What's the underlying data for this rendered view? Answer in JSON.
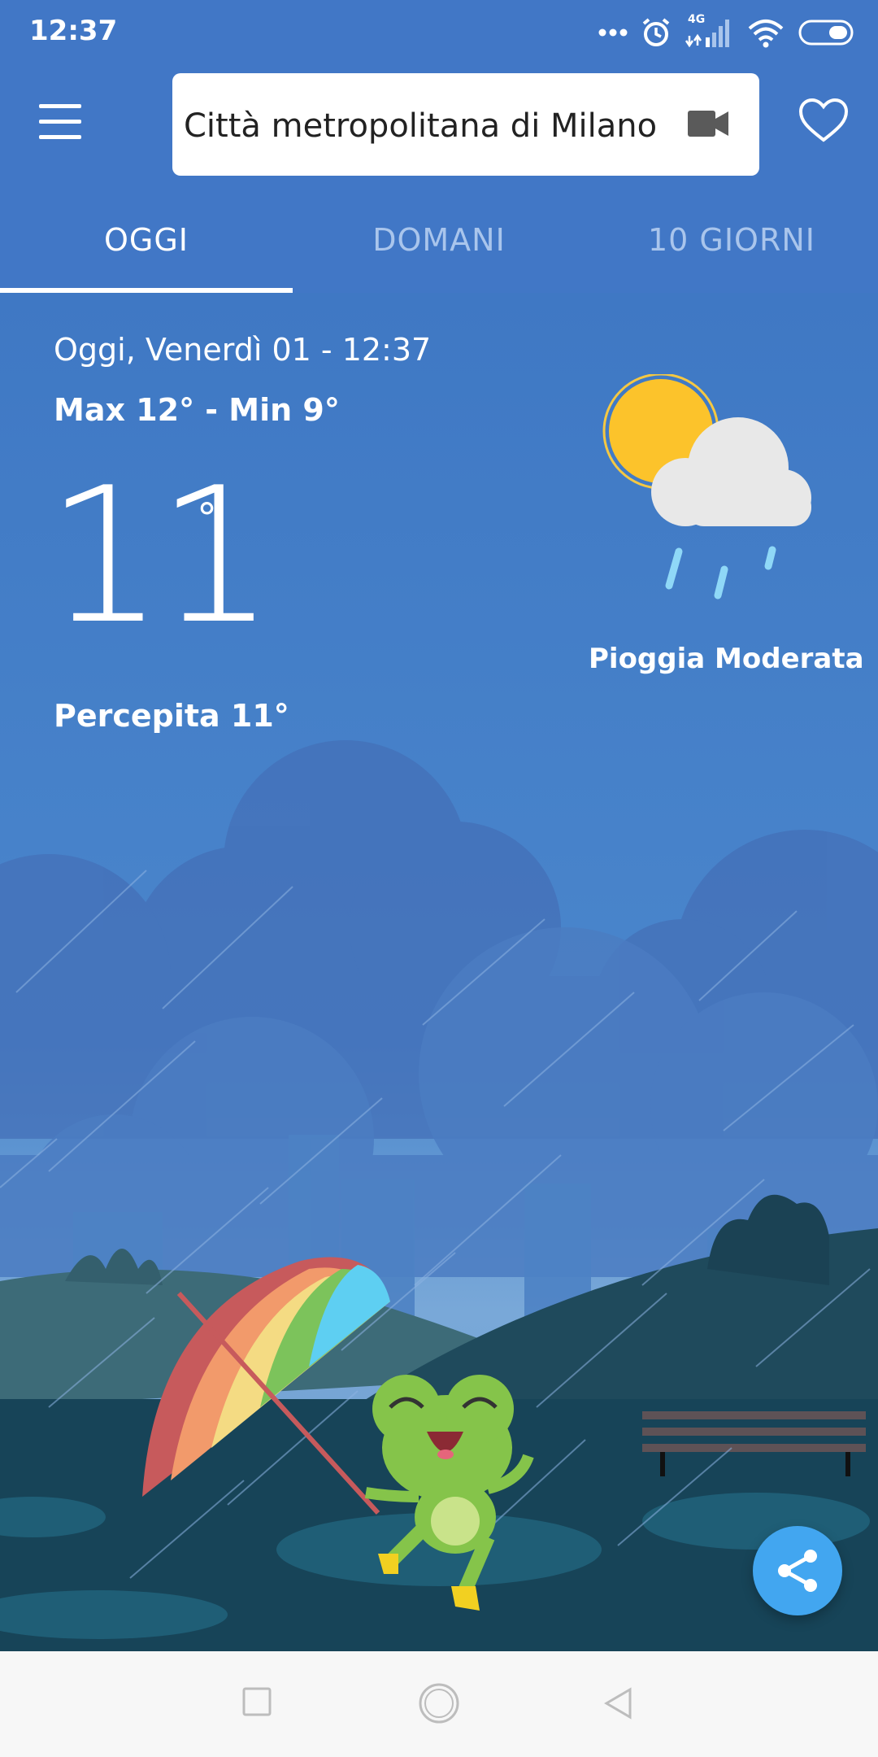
{
  "status_bar": {
    "time": "12:37",
    "network_label": "4G",
    "icons": [
      "dots-icon",
      "alarm-icon",
      "signal-icon",
      "wifi-icon",
      "battery-icon"
    ]
  },
  "app_bar": {
    "location": "Città metropolitana di Milano",
    "icons": [
      "menu-icon",
      "video-camera-icon",
      "heart-icon"
    ]
  },
  "tabs": [
    {
      "label": "OGGI",
      "active": true
    },
    {
      "label": "DOMANI",
      "active": false
    },
    {
      "label": "10 GIORNI",
      "active": false
    }
  ],
  "weather": {
    "date": "Oggi, Venerdì 01 - 12:37",
    "max_min": "Max 12° - Min 9°",
    "temperature": "11",
    "degree_symbol": "°",
    "feels_like": "Percepita 11°",
    "condition": "Pioggia Moderata",
    "condition_icon": "sun-cloud-rain-icon"
  },
  "scene": {
    "illustration": "frog-with-umbrella-in-rain"
  },
  "colors": {
    "app_blue": "#4177c6",
    "share_button": "#42a6f0",
    "nav_background": "#f7f7f7"
  },
  "navigation_bar": {
    "icons": [
      "square-icon",
      "circle-icon",
      "back-triangle-icon"
    ]
  }
}
